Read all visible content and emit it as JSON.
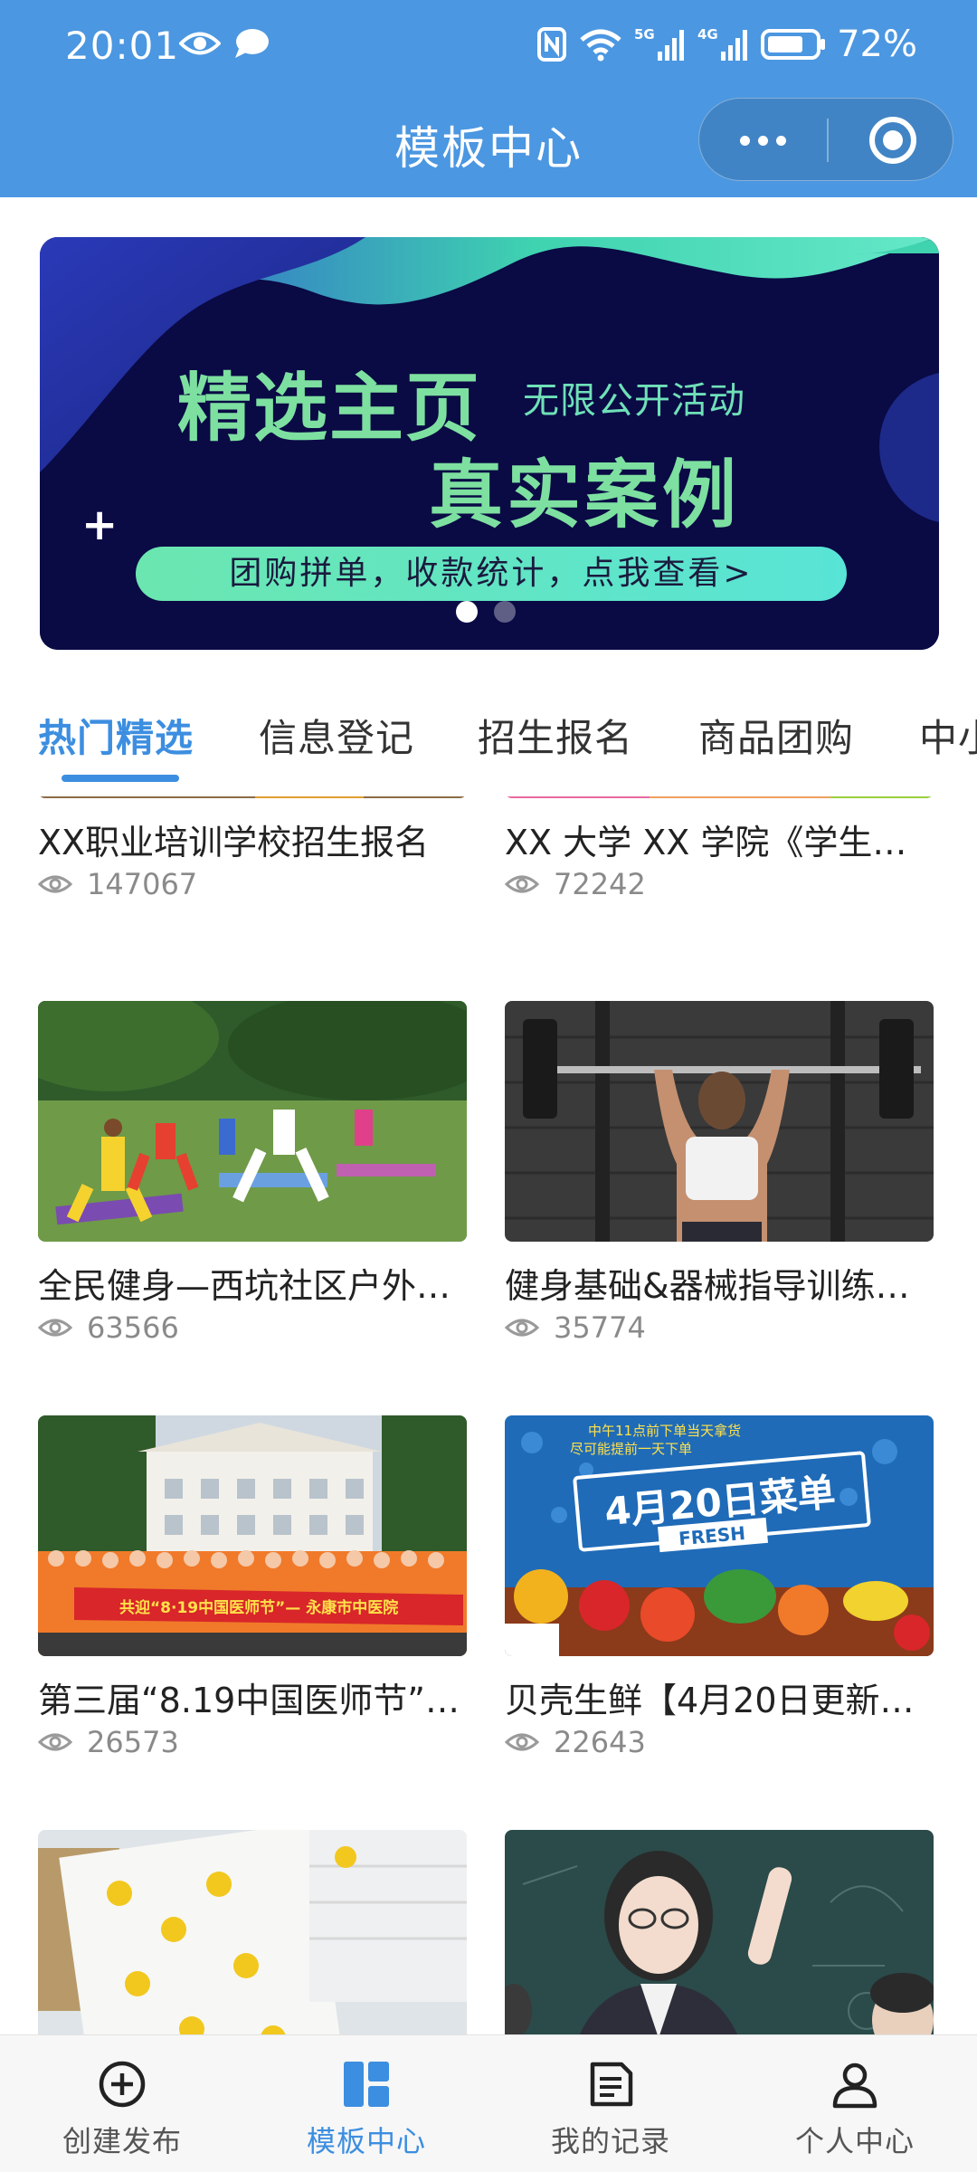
{
  "status_bar": {
    "time": "20:01",
    "battery": "72%"
  },
  "header": {
    "title": "模板中心"
  },
  "banner": {
    "title": "精选主页",
    "subtitle": "无限公开活动",
    "title2": "真实案例",
    "pill": "团购拼单，收款统计，点我查看>",
    "slide_count": 2,
    "active_slide": 1
  },
  "tabs": [
    {
      "label": "热门精选",
      "active": true
    },
    {
      "label": "信息登记",
      "active": false
    },
    {
      "label": "招生报名",
      "active": false
    },
    {
      "label": "商品团购",
      "active": false
    },
    {
      "label": "中小",
      "active": false
    }
  ],
  "cards": [
    {
      "title": "XX职业培训学校招生报名",
      "views": "147067"
    },
    {
      "title": "XX 大学 XX 学院《学生…",
      "views": "72242"
    },
    {
      "title": "全民健身—西坑社区户外…",
      "views": "63566"
    },
    {
      "title": "健身基础&器械指导训练…",
      "views": "35774"
    },
    {
      "title": "第三届“8.19中国医师节”…",
      "views": "26573"
    },
    {
      "title": "贝壳生鲜【4月20日更新…",
      "views": "22643"
    },
    {
      "title": "",
      "views": ""
    },
    {
      "title": "",
      "views": ""
    }
  ],
  "thumb_text": {
    "banner_3": "共迎“8·19中国医师节”— 永康市中医院",
    "menu_top": "中午11点前下单当天拿货",
    "menu_top2": "尽可能提前一天下单",
    "menu_title": "4月20日菜单",
    "menu_fresh": "FRESH"
  },
  "bottom_nav": [
    {
      "label": "创建发布",
      "icon": "plus-circle-icon",
      "active": false
    },
    {
      "label": "模板中心",
      "icon": "template-grid-icon",
      "active": true
    },
    {
      "label": "我的记录",
      "icon": "record-doc-icon",
      "active": false
    },
    {
      "label": "个人中心",
      "icon": "user-icon",
      "active": false
    }
  ],
  "colors": {
    "header_bg": "#4b97e1",
    "accent": "#3c8ee0",
    "banner_bg": "#0a0a45",
    "banner_green": "#7de0a0"
  }
}
